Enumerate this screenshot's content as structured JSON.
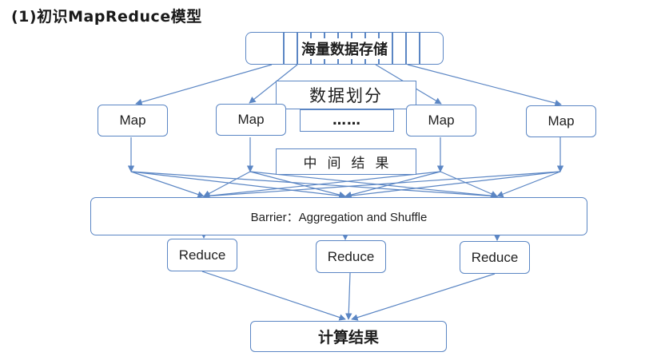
{
  "title": "(1)初识MapReduce模型",
  "diagram": {
    "storage": "海量数据存储",
    "split": "数据划分",
    "ellipsis": "……",
    "intermediate": "中间结果",
    "barrier": "Barrier：Aggregation and Shuffle",
    "maps": [
      "Map",
      "Map",
      "Map",
      "Map"
    ],
    "reduces": [
      "Reduce",
      "Reduce",
      "Reduce"
    ],
    "result": "计算结果"
  },
  "colors": {
    "line": "#5b86c4",
    "text": "#1f1f1f"
  }
}
